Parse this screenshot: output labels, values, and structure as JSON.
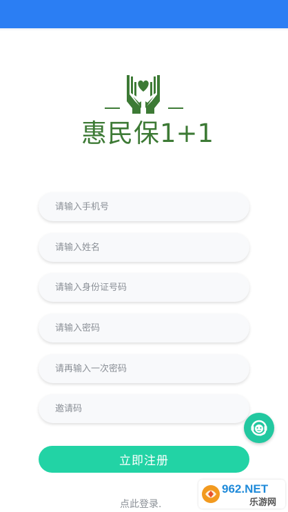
{
  "colors": {
    "status_bar": "#2b7ef3",
    "brand_green": "#3d7a35",
    "accent_teal": "#22d3a5",
    "placeholder": "#8a8f96"
  },
  "logo": {
    "text_cn": "惠民保",
    "text_num": "1+1"
  },
  "form": {
    "phone_placeholder": "请输入手机号",
    "name_placeholder": "请输入姓名",
    "id_placeholder": "请输入身份证号码",
    "password_placeholder": "请输入密码",
    "confirm_placeholder": "请再输入一次密码",
    "invite_placeholder": "邀请码",
    "submit_label": "立即注册"
  },
  "login_link": "点此登录.",
  "watermark": {
    "brand": "962.NET",
    "site": "乐游网"
  },
  "icons": {
    "customer_service": "headset-icon",
    "logo": "hands-heart-icon"
  }
}
